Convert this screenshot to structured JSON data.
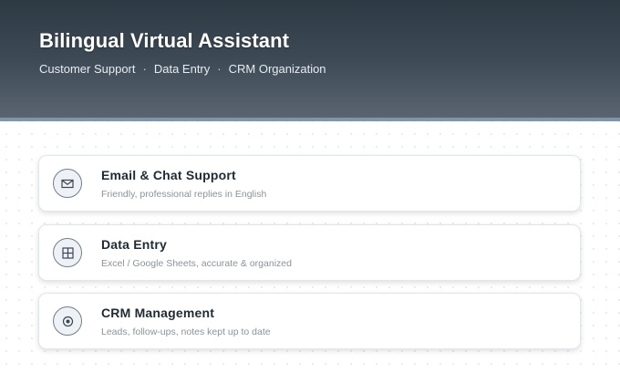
{
  "header": {
    "title": "Bilingual Virtual Assistant",
    "tags": [
      "Customer Support",
      "Data Entry",
      "CRM Organization"
    ],
    "separator": "·"
  },
  "services": [
    {
      "icon": "envelope-icon",
      "title": "Email & Chat Support",
      "description": "Friendly, professional replies in English"
    },
    {
      "icon": "grid-icon",
      "title": "Data Entry",
      "description": "Excel / Google Sheets, accurate & organized"
    },
    {
      "icon": "target-icon",
      "title": "CRM Management",
      "description": "Leads, follow-ups, notes kept up to date"
    }
  ],
  "colors": {
    "header_dark": "#2d3a44",
    "accent_stripe": "#7f95ab",
    "card_title": "#1f2a33",
    "card_desc": "#8a939b"
  }
}
